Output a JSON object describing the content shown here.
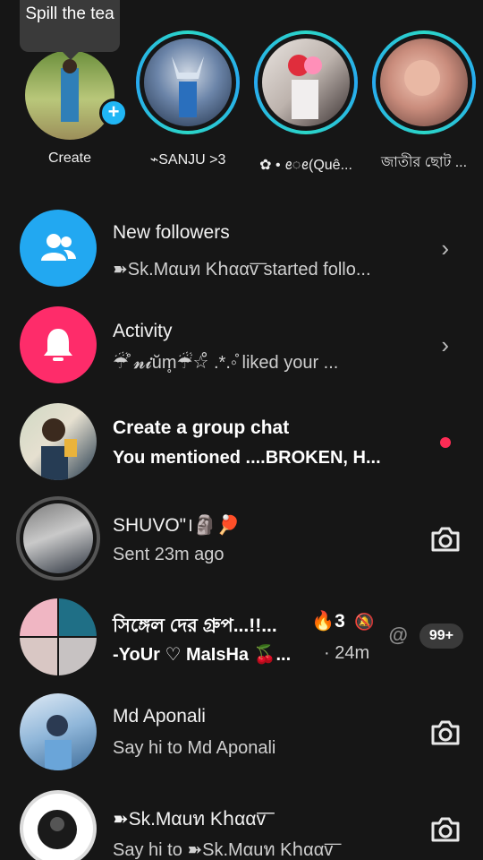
{
  "stories": {
    "bubble": "Spill the tea",
    "items": [
      {
        "name": "Create"
      },
      {
        "name": "⌁SANJU >3"
      },
      {
        "name": "✿ • ꫀ◌ꫀ(Quê..."
      },
      {
        "name": "জাতীর ছোট ..."
      }
    ]
  },
  "rows": {
    "followers": {
      "title": "New followers",
      "sub": "➽Sk.Mαuท Kհααv͞ started follo..."
    },
    "activity": {
      "title": "Activity",
      "sub": "☔̊ 𝓷𝓲ŭm̥☔☆̊ .*.◦̊ liked your ..."
    },
    "group": {
      "title": "Create a group chat",
      "sub": "You mentioned ....BROKEN, H..."
    },
    "shuvo": {
      "title": "SHUVO\"।🗿🏓",
      "sub": "Sent 23m ago"
    },
    "bangla": {
      "title": "সিঙ্গেল দের গ্রুপ...!!...",
      "streak": "🔥3",
      "sub": "-YoUr ♡ MaIsHa 🍒...",
      "time": "· 24m",
      "at": "@",
      "badge": "99+"
    },
    "aponali": {
      "title": "Md Aponali",
      "sub": "Say hi to Md Aponali"
    },
    "skmaun": {
      "title": "➽Sk.Mαuท Kհααv͞",
      "sub": "Say hi to ➽Sk.Mαuท Kհααv͞"
    }
  },
  "icons": {
    "chevron": "›",
    "plus": "+",
    "mute": "🔕"
  }
}
